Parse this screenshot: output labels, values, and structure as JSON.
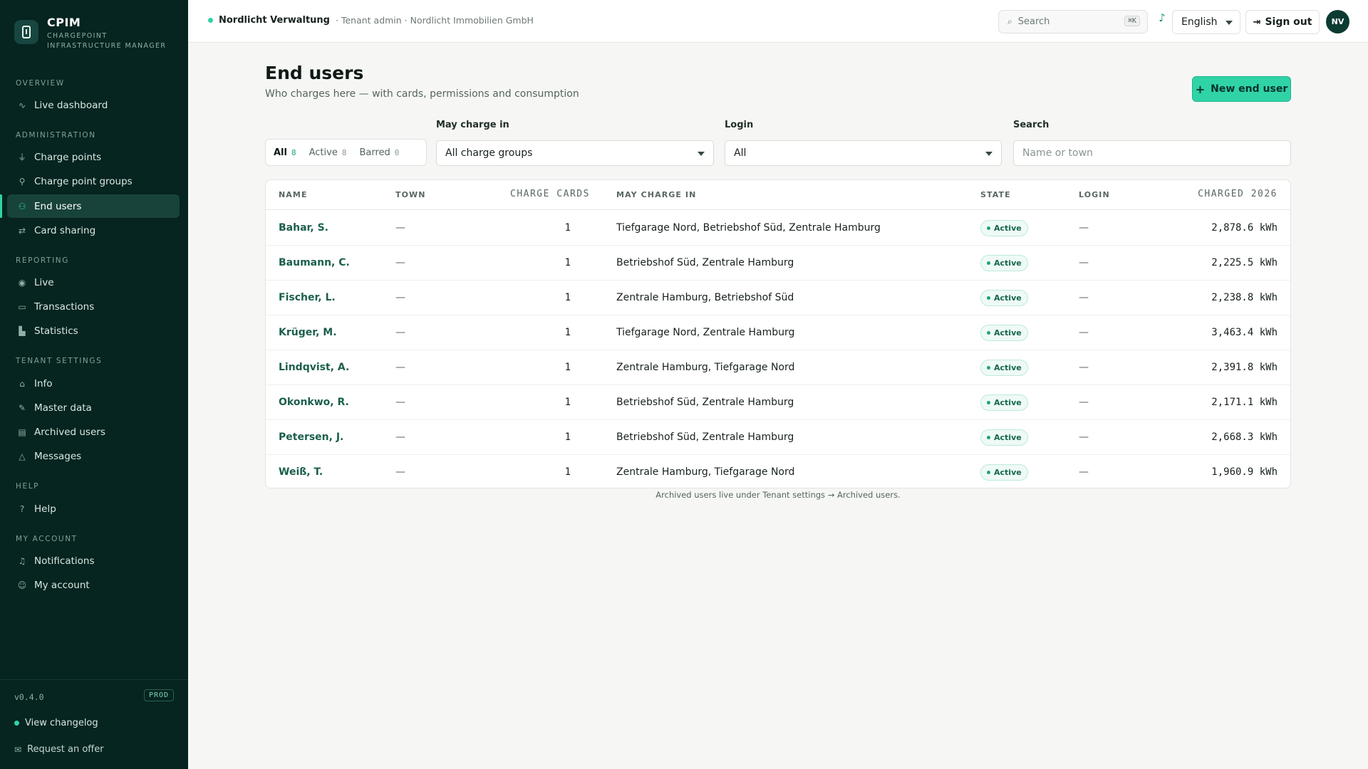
{
  "brand": {
    "name": "CPIM",
    "subtitle_line1": "CHARGEPOINT",
    "subtitle_line2": "INFRASTRUCTURE MANAGER"
  },
  "sidebar": {
    "sections": [
      {
        "label": "OVERVIEW"
      },
      {
        "label": "ADMINISTRATION"
      },
      {
        "label": "REPORTING"
      },
      {
        "label": "TENANT SETTINGS"
      },
      {
        "label": "HELP"
      },
      {
        "label": "MY ACCOUNT"
      }
    ],
    "items": [
      {
        "label": "Live dashboard",
        "icon": "activity-icon"
      },
      {
        "label": "Charge points",
        "icon": "plug-icon"
      },
      {
        "label": "Charge point groups",
        "icon": "tree-icon"
      },
      {
        "label": "End users",
        "icon": "user-icon"
      },
      {
        "label": "Card sharing",
        "icon": "swap-icon"
      },
      {
        "label": "Live",
        "icon": "radio-icon"
      },
      {
        "label": "Transactions",
        "icon": "card-icon"
      },
      {
        "label": "Statistics",
        "icon": "bar-chart-icon"
      },
      {
        "label": "Info",
        "icon": "home-icon"
      },
      {
        "label": "Master data",
        "icon": "pencil-icon"
      },
      {
        "label": "Archived users",
        "icon": "archive-icon"
      },
      {
        "label": "Messages",
        "icon": "warning-icon"
      },
      {
        "label": "Help",
        "icon": "help-icon"
      },
      {
        "label": "Notifications",
        "icon": "bell-icon"
      },
      {
        "label": "My account",
        "icon": "account-icon"
      }
    ],
    "active_item": "End users",
    "version": "v0.4.0",
    "env": "PROD",
    "changelog": "View changelog",
    "offer": "Request an offer"
  },
  "topbar": {
    "tenant_name": "Nordlicht Verwaltung",
    "tenant_role": "· Tenant admin · Nordlicht Immobilien GmbH",
    "search_placeholder": "Search",
    "search_shortcut": "⌘K",
    "language": "English",
    "sign_out": "Sign out",
    "avatar_initials": "NV"
  },
  "page": {
    "title": "End users",
    "subtitle": "Who charges here — with cards, permissions and consumption",
    "new_button": "New end user"
  },
  "filters": {
    "tabs": [
      {
        "label": "All",
        "count": "8"
      },
      {
        "label": "Active",
        "count": "8"
      },
      {
        "label": "Barred",
        "count": "0"
      }
    ],
    "may_charge_label": "May charge in",
    "may_charge_value": "All charge groups",
    "login_label": "Login",
    "login_value": "All",
    "search_label": "Search",
    "search_placeholder": "Name or town"
  },
  "table": {
    "columns": {
      "name": "NAME",
      "town": "TOWN",
      "cards": "CHARGE CARDS",
      "may_charge": "MAY CHARGE IN",
      "state": "STATE",
      "login": "LOGIN",
      "charged": "CHARGED 2026"
    },
    "rows": [
      {
        "name": "Bahar, S.",
        "town": "—",
        "cards": "1",
        "may_charge": "Tiefgarage Nord, Betriebshof Süd, Zentrale Hamburg",
        "state": "Active",
        "login": "—",
        "charged": "2,878.6 kWh"
      },
      {
        "name": "Baumann, C.",
        "town": "—",
        "cards": "1",
        "may_charge": "Betriebshof Süd, Zentrale Hamburg",
        "state": "Active",
        "login": "—",
        "charged": "2,225.5 kWh"
      },
      {
        "name": "Fischer, L.",
        "town": "—",
        "cards": "1",
        "may_charge": "Zentrale Hamburg, Betriebshof Süd",
        "state": "Active",
        "login": "—",
        "charged": "2,238.8 kWh"
      },
      {
        "name": "Krüger, M.",
        "town": "—",
        "cards": "1",
        "may_charge": "Tiefgarage Nord, Zentrale Hamburg",
        "state": "Active",
        "login": "—",
        "charged": "3,463.4 kWh"
      },
      {
        "name": "Lindqvist, A.",
        "town": "—",
        "cards": "1",
        "may_charge": "Zentrale Hamburg, Tiefgarage Nord",
        "state": "Active",
        "login": "—",
        "charged": "2,391.8 kWh"
      },
      {
        "name": "Okonkwo, R.",
        "town": "—",
        "cards": "1",
        "may_charge": "Betriebshof Süd, Zentrale Hamburg",
        "state": "Active",
        "login": "—",
        "charged": "2,171.1 kWh"
      },
      {
        "name": "Petersen, J.",
        "town": "—",
        "cards": "1",
        "may_charge": "Betriebshof Süd, Zentrale Hamburg",
        "state": "Active",
        "login": "—",
        "charged": "2,668.3 kWh"
      },
      {
        "name": "Weiß, T.",
        "town": "—",
        "cards": "1",
        "may_charge": "Zentrale Hamburg, Tiefgarage Nord",
        "state": "Active",
        "login": "—",
        "charged": "1,960.9 kWh"
      }
    ]
  },
  "footnote": "Archived users live under Tenant settings → Archived users.",
  "colors": {
    "sidebar_bg": "#062420",
    "accent": "#2fd3a6",
    "link": "#1b5f4d"
  }
}
